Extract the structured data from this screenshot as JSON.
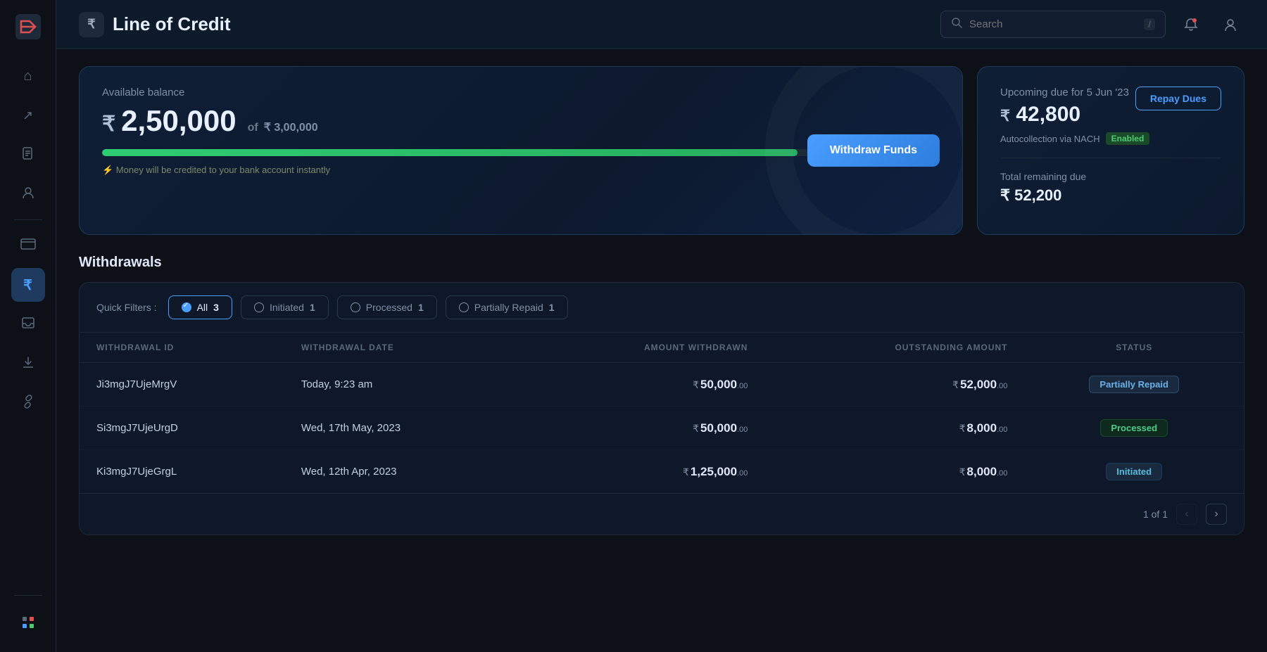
{
  "header": {
    "title": "Line of Credit",
    "title_icon": "₹",
    "search_placeholder": "Search"
  },
  "sidebar": {
    "items": [
      {
        "id": "home",
        "icon": "⊞",
        "label": "Home"
      },
      {
        "id": "arrow-up",
        "icon": "↗",
        "label": "Export"
      },
      {
        "id": "document",
        "icon": "📄",
        "label": "Documents"
      },
      {
        "id": "person",
        "icon": "👤",
        "label": "Profile"
      },
      {
        "id": "card",
        "icon": "▭",
        "label": "Cards"
      },
      {
        "id": "rupee",
        "icon": "₹",
        "label": "Line of Credit",
        "active": true
      },
      {
        "id": "inbox",
        "icon": "⊟",
        "label": "Inbox"
      },
      {
        "id": "download",
        "icon": "⬇",
        "label": "Download"
      },
      {
        "id": "link",
        "icon": "🔗",
        "label": "Links"
      },
      {
        "id": "grid",
        "icon": "⊞",
        "label": "Apps"
      }
    ]
  },
  "balance_card": {
    "label": "Available balance",
    "amount": "2,50,000",
    "rupee_symbol": "₹",
    "of_text": "of",
    "limit": "₹ 3,00,000",
    "progress_percent": 83,
    "note": "⚡ Money will be credited to your bank account instantly",
    "withdraw_btn": "Withdraw Funds"
  },
  "due_card": {
    "title": "Upcoming due for 5 Jun '23",
    "amount": "42,800",
    "rupee_symbol": "₹",
    "repay_btn": "Repay Dues",
    "nach_label": "Autocollection via NACH",
    "nach_status": "Enabled",
    "remaining_label": "Total remaining due",
    "remaining_amount": "₹ 52,200"
  },
  "withdrawals": {
    "section_title": "Withdrawals",
    "filters": {
      "label": "Quick Filters :",
      "items": [
        {
          "id": "all",
          "label": "All",
          "count": "3",
          "active": true
        },
        {
          "id": "initiated",
          "label": "Initiated",
          "count": "1",
          "active": false
        },
        {
          "id": "processed",
          "label": "Processed",
          "count": "1",
          "active": false
        },
        {
          "id": "partially-repaid",
          "label": "Partially Repaid",
          "count": "1",
          "active": false
        }
      ]
    },
    "table": {
      "columns": [
        {
          "id": "id",
          "label": "WITHDRAWAL ID"
        },
        {
          "id": "date",
          "label": "WITHDRAWAL DATE"
        },
        {
          "id": "amount",
          "label": "AMOUNT WITHDRAWN"
        },
        {
          "id": "outstanding",
          "label": "OUTSTANDING AMOUNT"
        },
        {
          "id": "status",
          "label": "STATUS"
        }
      ],
      "rows": [
        {
          "id": "Ji3mgJ7UjeMrgV",
          "date": "Today, 9:23 am",
          "amount_main": "50,000",
          "amount_sup": ".00",
          "outstanding_main": "52,000",
          "outstanding_sup": ".00",
          "status": "Partially Repaid",
          "status_type": "partially-repaid"
        },
        {
          "id": "Si3mgJ7UjeUrgD",
          "date": "Wed, 17th May, 2023",
          "amount_main": "50,000",
          "amount_sup": ".00",
          "outstanding_main": "8,000",
          "outstanding_sup": ".00",
          "status": "Processed",
          "status_type": "processed"
        },
        {
          "id": "Ki3mgJ7UjeGrgL",
          "date": "Wed, 12th Apr, 2023",
          "amount_main": "1,25,000",
          "amount_sup": ".00",
          "outstanding_main": "8,000",
          "outstanding_sup": ".00",
          "status": "Initiated",
          "status_type": "initiated"
        }
      ]
    },
    "pagination": {
      "page_info": "1 of 1"
    }
  }
}
